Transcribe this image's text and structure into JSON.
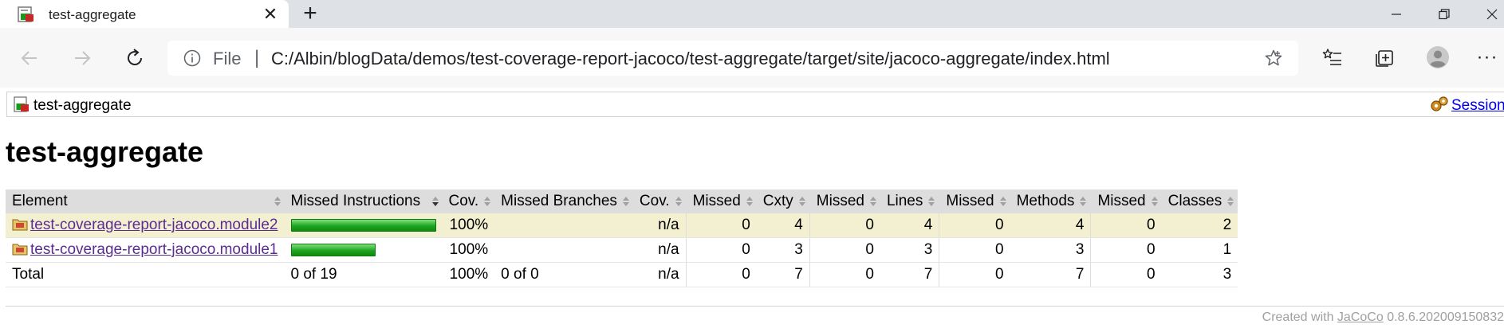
{
  "browser": {
    "tab_title": "test-aggregate",
    "new_tab_label": "+",
    "address_scheme": "File",
    "address_separator": "|",
    "url": "C:/Albin/blogData/demos/test-coverage-report-jacoco/test-aggregate/target/site/jacoco-aggregate/index.html",
    "more_label": "···"
  },
  "page": {
    "breadcrumb": "test-aggregate",
    "sessions_link": "Sessions",
    "title": "test-aggregate"
  },
  "table": {
    "headers": {
      "element": "Element",
      "missed_instructions": "Missed Instructions",
      "cov_instructions": "Cov.",
      "missed_branches": "Missed Branches",
      "cov_branches": "Cov.",
      "missed_cxty": "Missed",
      "cxty": "Cxty",
      "missed_lines": "Missed",
      "lines": "Lines",
      "missed_methods": "Missed",
      "methods": "Methods",
      "missed_classes": "Missed",
      "classes": "Classes"
    },
    "rows": [
      {
        "name": "test-coverage-report-jacoco.module2",
        "instr_bar_fraction": 1.0,
        "instr_cov": "100%",
        "branch_cov": "n/a",
        "missed_cxty": "0",
        "cxty": "4",
        "missed_lines": "0",
        "lines": "4",
        "missed_methods": "0",
        "methods": "4",
        "missed_classes": "0",
        "classes": "2"
      },
      {
        "name": "test-coverage-report-jacoco.module1",
        "instr_bar_fraction": 0.58,
        "instr_cov": "100%",
        "branch_cov": "n/a",
        "missed_cxty": "0",
        "cxty": "3",
        "missed_lines": "0",
        "lines": "3",
        "missed_methods": "0",
        "methods": "3",
        "missed_classes": "0",
        "classes": "1"
      }
    ],
    "total": {
      "label": "Total",
      "instructions": "0 of 19",
      "instr_cov": "100%",
      "branches": "0 of 0",
      "branch_cov": "n/a",
      "missed_cxty": "0",
      "cxty": "7",
      "missed_lines": "0",
      "lines": "7",
      "missed_methods": "0",
      "methods": "7",
      "missed_classes": "0",
      "classes": "3"
    }
  },
  "footer": {
    "prefix": "Created with",
    "link": "JaCoCo",
    "version": "0.8.6.202009150832"
  },
  "colors": {
    "highlight_row": "#f2f0d1",
    "header_bg": "#dddddd",
    "link": "#5c2d91",
    "bar_green": "#1fa51f"
  }
}
